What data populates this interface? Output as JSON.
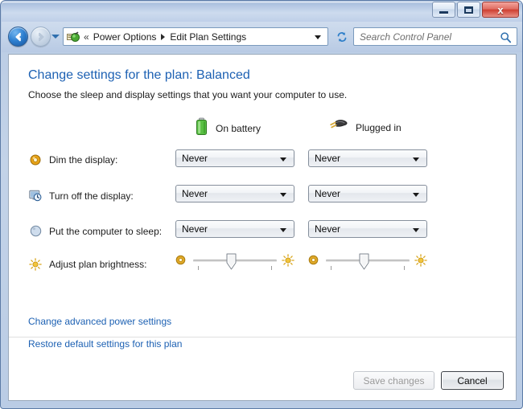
{
  "window": {
    "caption": {
      "minimize_label": "Minimize",
      "maximize_label": "Maximize",
      "close_label": "x"
    }
  },
  "toolbar": {
    "back_label": "Back",
    "forward_label": "Forward",
    "recent_pages_label": "Recent pages",
    "address": {
      "icon": "power-options-icon",
      "overflow_chevrons": "«",
      "crumbs": [
        "Power Options",
        "Edit Plan Settings"
      ],
      "dropdown_label": "Previous locations"
    },
    "refresh_label": "Refresh",
    "search": {
      "placeholder": "Search Control Panel",
      "value": "",
      "icon": "search-icon"
    }
  },
  "page": {
    "heading": "Change settings for the plan: Balanced",
    "subheading": "Choose the sleep and display settings that you want your computer to use.",
    "columns": [
      {
        "id": "on-battery",
        "label": "On battery",
        "icon": "battery-icon"
      },
      {
        "id": "plugged-in",
        "label": "Plugged in",
        "icon": "power-plug-icon"
      }
    ],
    "settings": [
      {
        "id": "dim-the-display",
        "label": "Dim the display:",
        "icon": "dim-display-icon",
        "on_battery": "Never",
        "plugged_in": "Never"
      },
      {
        "id": "turn-off-the-display",
        "label": "Turn off the display:",
        "icon": "turn-off-display-icon",
        "on_battery": "Never",
        "plugged_in": "Never"
      },
      {
        "id": "put-the-computer-to-sleep",
        "label": "Put the computer to sleep:",
        "icon": "sleep-moon-icon",
        "on_battery": "Never",
        "plugged_in": "Never"
      }
    ],
    "brightness": {
      "id": "adjust-plan-brightness",
      "label": "Adjust plan brightness:",
      "icon": "brightness-sun-icon",
      "low_icon": "dim-sun-icon",
      "high_icon": "bright-sun-icon",
      "on_battery_value": 50,
      "plugged_in_value": 50,
      "min": 0,
      "max": 100
    },
    "links": [
      {
        "id": "change-advanced-power-settings",
        "label": "Change advanced power settings"
      },
      {
        "id": "restore-default-settings-for-this-plan",
        "label": "Restore default settings for this plan"
      }
    ],
    "buttons": {
      "save": {
        "label": "Save changes",
        "enabled": false
      },
      "cancel": {
        "label": "Cancel",
        "enabled": true,
        "default": true
      }
    }
  },
  "colors": {
    "link": "#1d61b3",
    "heading": "#1d61b3",
    "battery_green": "#5cc14a",
    "sun_gold": "#e8a317",
    "close_red": "#cf3f31",
    "title_blue": "#b2c6e2"
  }
}
